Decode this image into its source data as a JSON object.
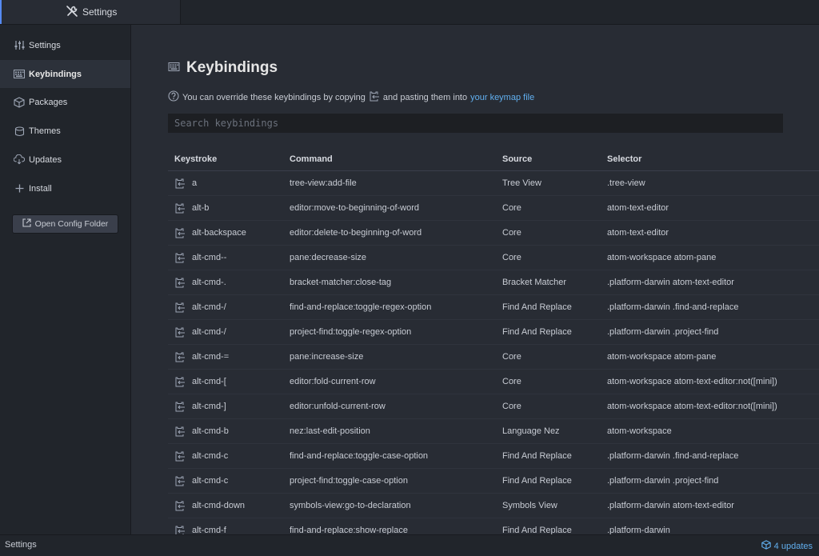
{
  "tab": {
    "title": "Settings",
    "icon": "tools-icon"
  },
  "sidebar": {
    "items": [
      {
        "label": "Settings",
        "icon": "sliders-icon",
        "active": false
      },
      {
        "label": "Keybindings",
        "icon": "keyboard-icon",
        "active": true
      },
      {
        "label": "Packages",
        "icon": "package-icon",
        "active": false
      },
      {
        "label": "Themes",
        "icon": "paintcan-icon",
        "active": false
      },
      {
        "label": "Updates",
        "icon": "cloud-download-icon",
        "active": false
      },
      {
        "label": "Install",
        "icon": "plus-icon",
        "active": false
      }
    ],
    "config_button": "Open Config Folder"
  },
  "main": {
    "title": "Keybindings",
    "desc_before": "You can override these keybindings by copying",
    "desc_after": "and pasting them into",
    "desc_link": "your keymap file",
    "search_placeholder": "Search keybindings",
    "columns": [
      "Keystroke",
      "Command",
      "Source",
      "Selector"
    ],
    "rows": [
      [
        "a",
        "tree-view:add-file",
        "Tree View",
        ".tree-view"
      ],
      [
        "alt-b",
        "editor:move-to-beginning-of-word",
        "Core",
        "atom-text-editor"
      ],
      [
        "alt-backspace",
        "editor:delete-to-beginning-of-word",
        "Core",
        "atom-text-editor"
      ],
      [
        "alt-cmd--",
        "pane:decrease-size",
        "Core",
        "atom-workspace atom-pane"
      ],
      [
        "alt-cmd-.",
        "bracket-matcher:close-tag",
        "Bracket Matcher",
        ".platform-darwin atom-text-editor"
      ],
      [
        "alt-cmd-/",
        "find-and-replace:toggle-regex-option",
        "Find And Replace",
        ".platform-darwin .find-and-replace"
      ],
      [
        "alt-cmd-/",
        "project-find:toggle-regex-option",
        "Find And Replace",
        ".platform-darwin .project-find"
      ],
      [
        "alt-cmd-=",
        "pane:increase-size",
        "Core",
        "atom-workspace atom-pane"
      ],
      [
        "alt-cmd-[",
        "editor:fold-current-row",
        "Core",
        "atom-workspace atom-text-editor:not([mini])"
      ],
      [
        "alt-cmd-]",
        "editor:unfold-current-row",
        "Core",
        "atom-workspace atom-text-editor:not([mini])"
      ],
      [
        "alt-cmd-b",
        "nez:last-edit-position",
        "Language Nez",
        "atom-workspace"
      ],
      [
        "alt-cmd-c",
        "find-and-replace:toggle-case-option",
        "Find And Replace",
        ".platform-darwin .find-and-replace"
      ],
      [
        "alt-cmd-c",
        "project-find:toggle-case-option",
        "Find And Replace",
        ".platform-darwin .project-find"
      ],
      [
        "alt-cmd-down",
        "symbols-view:go-to-declaration",
        "Symbols View",
        ".platform-darwin atom-text-editor"
      ],
      [
        "alt-cmd-f",
        "find-and-replace:show-replace",
        "Find And Replace",
        ".platform-darwin"
      ]
    ]
  },
  "statusbar": {
    "left": "Settings",
    "updates": "4 updates"
  },
  "colors": {
    "accent": "#568af2",
    "link": "#61afef",
    "background": "#282c34",
    "sidebar": "#21252b"
  }
}
